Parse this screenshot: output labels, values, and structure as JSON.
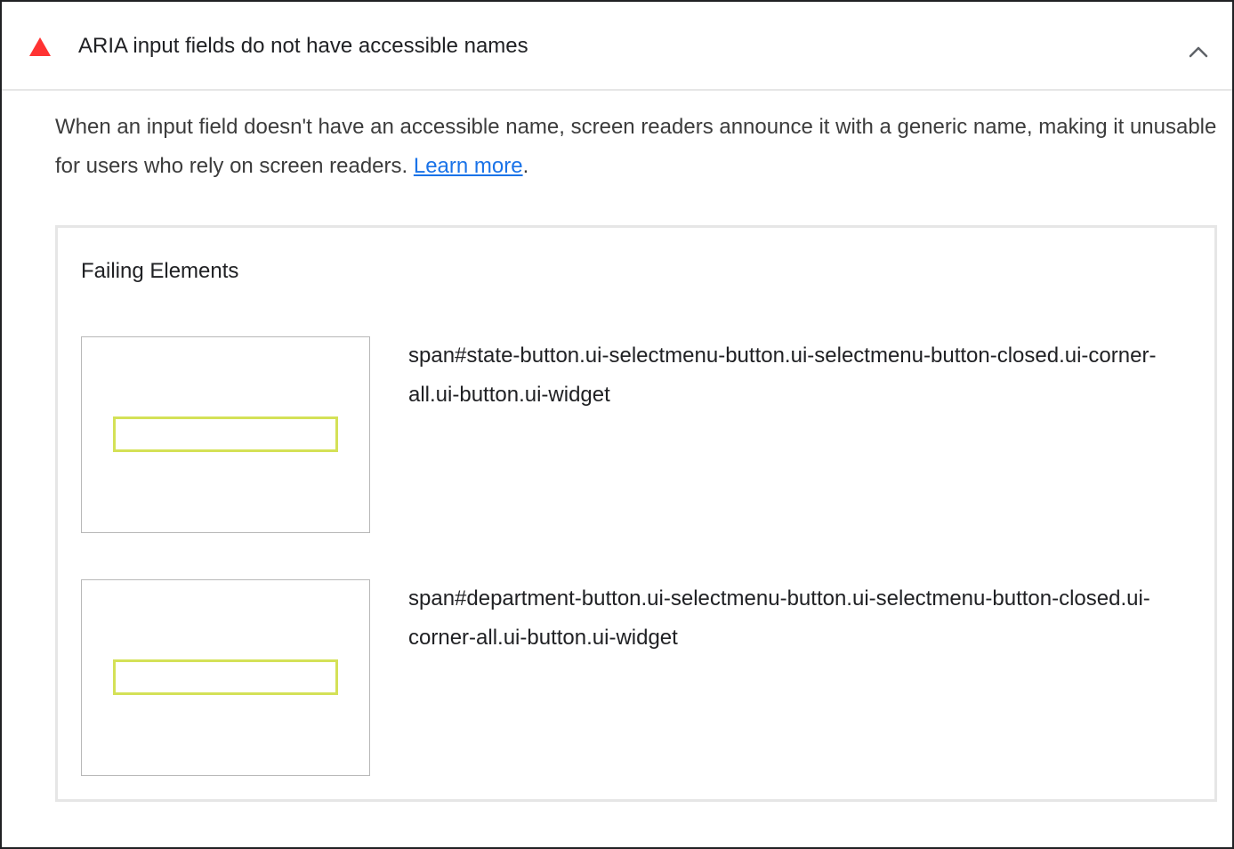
{
  "audit": {
    "title": "ARIA input fields do not have accessible names",
    "status_icon": "warning-triangle-icon",
    "status_color": "#ff3333",
    "expanded": true,
    "collapse_icon": "chevron-up-icon"
  },
  "description": {
    "text": "When an input field doesn't have an accessible name, screen readers announce it with a generic name, making it unusable for users who rely on screen readers. ",
    "link_text": "Learn more",
    "suffix": ".",
    "link_color": "#1a73e8"
  },
  "failing": {
    "heading": "Failing Elements",
    "highlight_color": "#d4e157",
    "items": [
      {
        "selector": "span#state-button.ui-selectmenu-button.ui-selectmenu-button-closed.ui-corner-all.ui-button.ui-widget"
      },
      {
        "selector": "span#department-button.ui-selectmenu-button.ui-selectmenu-button-closed.ui-corner-all.ui-button.ui-widget"
      }
    ]
  }
}
